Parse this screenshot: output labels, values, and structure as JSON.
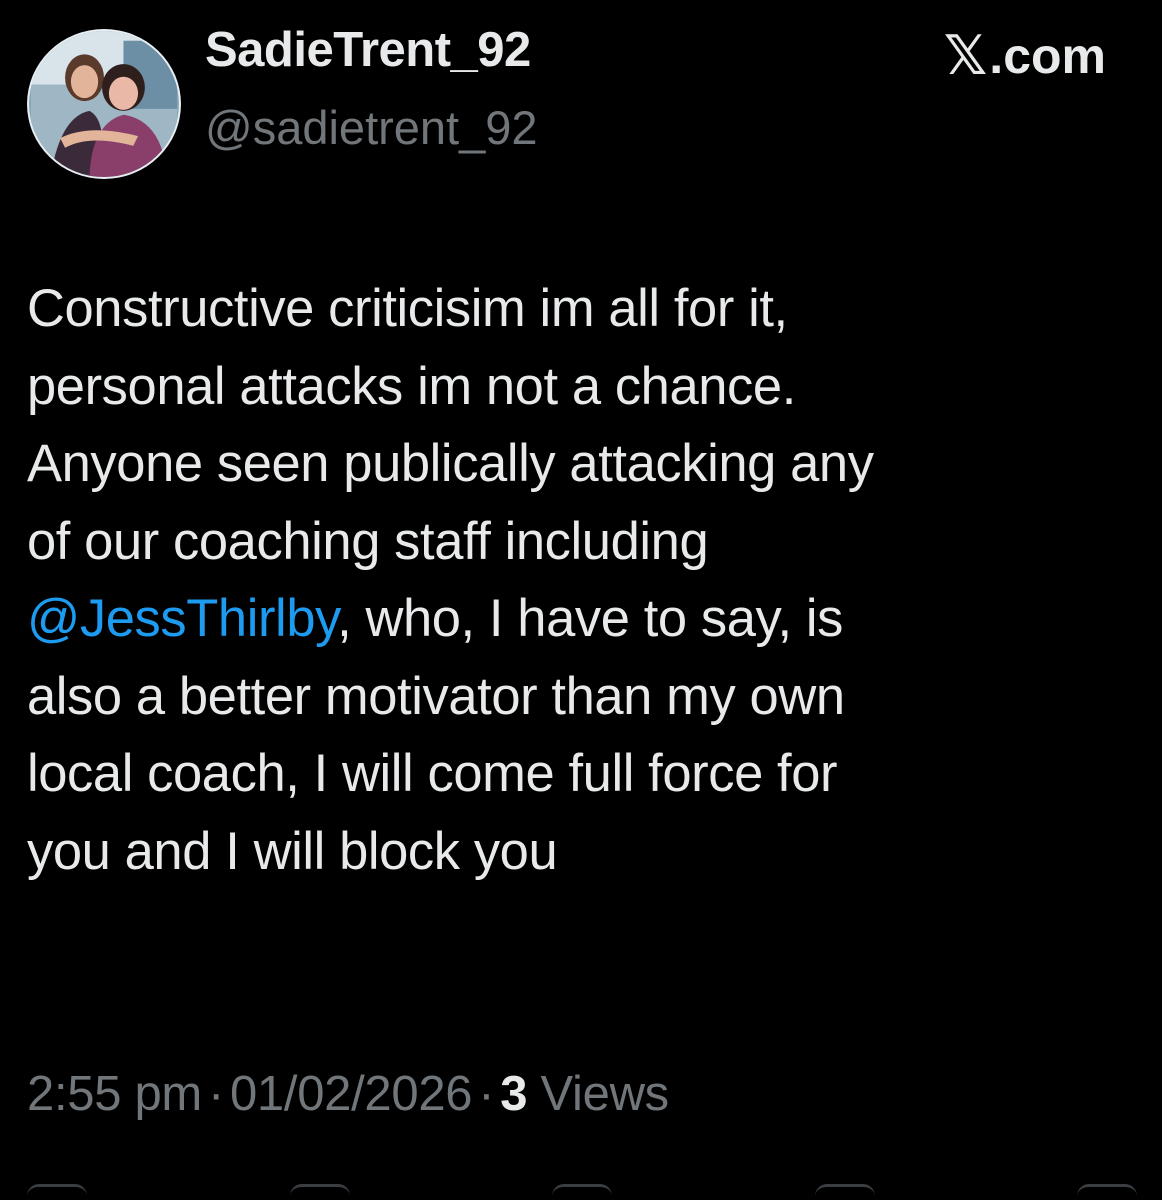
{
  "author": {
    "display_name": "SadieTrent_92",
    "handle": "@sadietrent_92",
    "avatar_icon": "profile-photo"
  },
  "brand": {
    "label": ".com",
    "logo_glyph": "𝕏"
  },
  "tweet": {
    "lines": [
      {
        "text": "Constructive criticisim im all for it,"
      },
      {
        "text": "personal attacks im not a chance."
      },
      {
        "text": "Anyone seen publically attacking any"
      },
      {
        "text": "of our coaching staff including"
      },
      {
        "mention": "@JessThirlby",
        "text": ", who, I have to say, is"
      },
      {
        "text": "also a better motivator than my own"
      },
      {
        "text": "local coach, I will come full force for"
      },
      {
        "text": "you and I will block you"
      }
    ]
  },
  "meta": {
    "time": "2:55 pm",
    "separator": "·",
    "date": "01/02/2026",
    "views_count": "3",
    "views_label": "Views"
  },
  "colors": {
    "background": "#000000",
    "text_primary": "#e7e9ea",
    "text_secondary": "#71767b",
    "mention": "#1d9bf0"
  }
}
